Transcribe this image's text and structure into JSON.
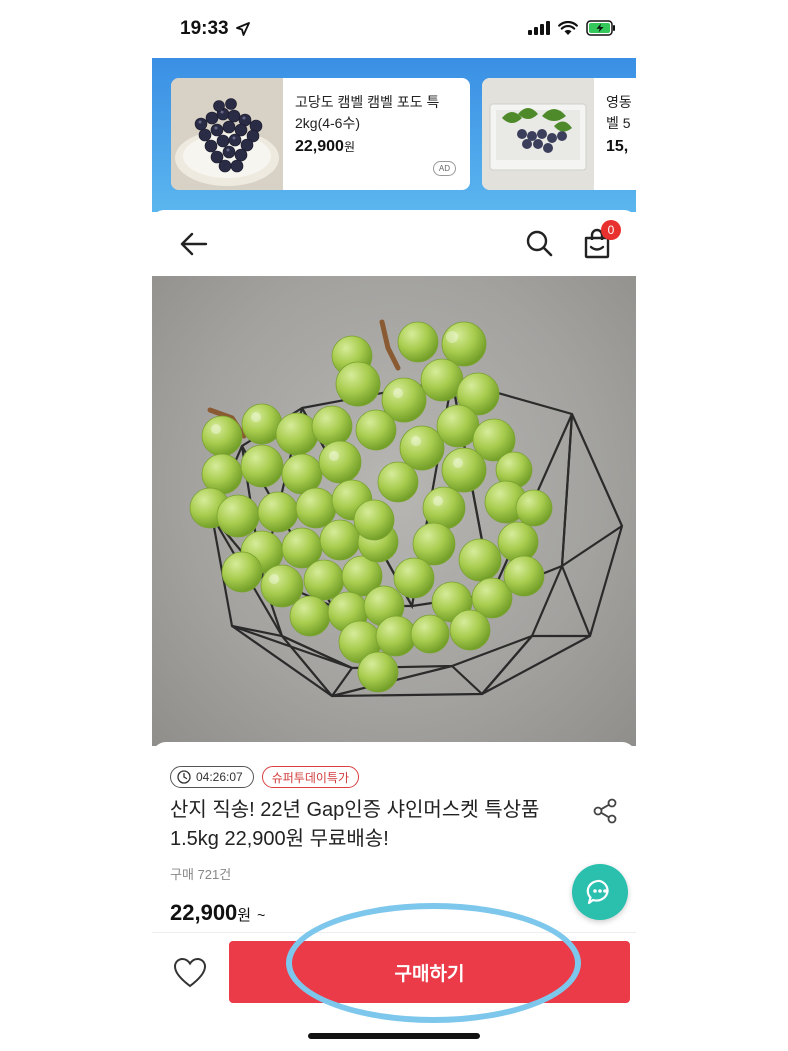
{
  "status_bar": {
    "time": "19:33",
    "location_icon": "location-arrow-icon",
    "signal_icon": "cellular-signal-icon",
    "wifi_icon": "wifi-icon",
    "battery_icon": "battery-charging-icon",
    "battery_color": "#34c759"
  },
  "ad_banner": {
    "cards": [
      {
        "title": "고당도 캠벨 캠벨 포도 특 2kg(4-6수)",
        "price": "22,900",
        "currency": "원",
        "badge": "AD"
      },
      {
        "title": "영동 벨 5",
        "price": "15,",
        "currency": ""
      }
    ]
  },
  "header": {
    "back_icon": "back-arrow-icon",
    "search_icon": "search-icon",
    "cart_icon": "shopping-bag-icon",
    "cart_count": "0"
  },
  "product": {
    "image": "shine-muscat-grapes-in-wire-basket",
    "timer": "04:26:07",
    "tag": "슈퍼투데이특가",
    "title": "산지 직송! 22년 Gap인증 샤인머스켓 특상품 1.5kg 22,900원 무료배송!",
    "purchase_count": "구매 721건",
    "price": "22,900",
    "currency": "원",
    "price_suffix": "~"
  },
  "bottom_bar": {
    "wish_icon": "heart-icon",
    "buy_label": "구매하기"
  },
  "colors": {
    "accent": "#eb3a48",
    "chat": "#2bbfae",
    "banner_top": "#3a8fe4",
    "highlight": "#7ec7ec"
  }
}
